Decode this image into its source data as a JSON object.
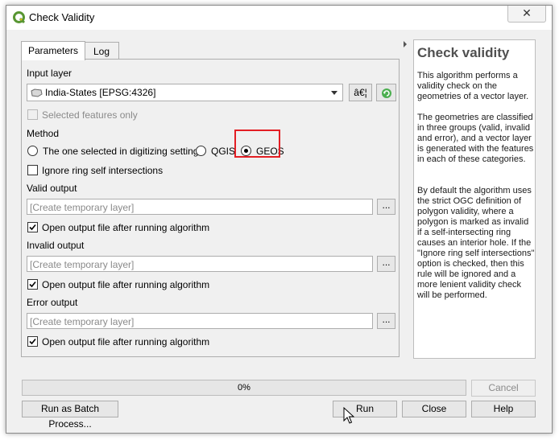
{
  "window": {
    "title": "Check Validity",
    "close_glyph": "✕"
  },
  "tabs": [
    {
      "label": "Parameters",
      "active": true
    },
    {
      "label": "Log",
      "active": false
    }
  ],
  "params": {
    "input_layer_label": "Input layer",
    "input_layer_value": "India-States [EPSG:4326]",
    "input_layer_btn1": "â€¦",
    "selected_only": {
      "label": "Selected features only",
      "checked": false,
      "enabled": false
    },
    "method_label": "Method",
    "method_options": [
      {
        "label": "The one selected in digitizing settings",
        "selected": false
      },
      {
        "label": "QGIS",
        "selected": false
      },
      {
        "label": "GEOS",
        "selected": true
      }
    ],
    "ignore_ring": {
      "label": "Ignore ring self intersections",
      "checked": false
    },
    "valid_output": {
      "label": "Valid output",
      "placeholder": "[Create temporary layer]",
      "ellipsis": "...",
      "open_label": "Open output file after running algorithm",
      "open_checked": true
    },
    "invalid_output": {
      "label": "Invalid output",
      "placeholder": "[Create temporary layer]",
      "ellipsis": "...",
      "open_label": "Open output file after running algorithm",
      "open_checked": true
    },
    "error_output": {
      "label": "Error output",
      "placeholder": "[Create temporary layer]",
      "ellipsis": "...",
      "open_label": "Open output file after running algorithm",
      "open_checked": true
    }
  },
  "help": {
    "title": "Check validity",
    "paragraphs": [
      "This algorithm performs a validity check on the geometries of a vector layer.",
      "The geometries are classified in three groups (valid, invalid and error), and a vector layer is generated with the features in each of these categories.",
      "By default the algorithm uses the strict OGC definition of polygon validity, where a polygon is marked as invalid if a self-intersecting ring causes an interior hole. If the \"Ignore ring self intersections\" option is checked, then this rule will be ignored and a more lenient validity check will be performed."
    ]
  },
  "progress": {
    "value": 0,
    "text": "0%"
  },
  "footer": {
    "batch": "Run as Batch Process...",
    "run": "Run",
    "close": "Close",
    "help": "Help",
    "cancel": "Cancel"
  },
  "colors": {
    "highlight": "#e31e24",
    "qgis_green": "#589632",
    "window_bg": "#f0f0f0"
  }
}
